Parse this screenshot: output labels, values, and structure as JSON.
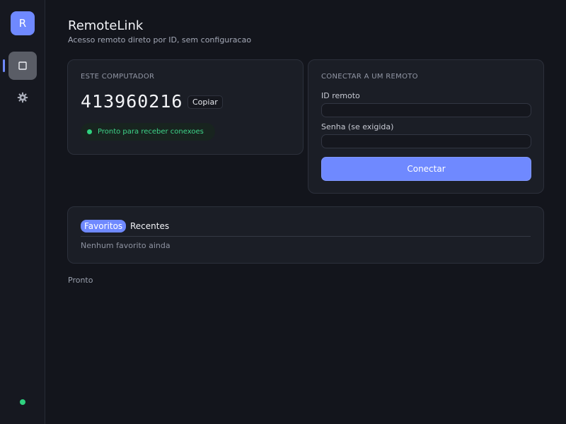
{
  "sidebar": {
    "logo_letter": "R",
    "nav": [
      {
        "name": "home",
        "icon": "square-icon",
        "active": true
      },
      {
        "name": "settings",
        "icon": "gear-icon",
        "active": false
      }
    ],
    "connection_status_color": "#2fd17f"
  },
  "header": {
    "title": "RemoteLink",
    "subtitle": "Acesso remoto direto por ID, sem configuracao"
  },
  "local": {
    "label": "ESTE COMPUTADOR",
    "id": "413960216",
    "copy_label": "Copiar",
    "status": "Pronto para receber conexoes",
    "status_color": "#2fd17f"
  },
  "remote": {
    "label": "CONECTAR A UM REMOTO",
    "id_label": "ID remoto",
    "id_value": "",
    "password_label": "Senha (se exigida)",
    "password_value": "",
    "connect_label": "Conectar"
  },
  "lists": {
    "tabs": [
      {
        "label": "Favoritos",
        "active": true
      },
      {
        "label": "Recentes",
        "active": false
      }
    ],
    "empty_message": "Nenhum favorito ainda"
  },
  "status_bar": {
    "text": "Pronto"
  },
  "colors": {
    "accent": "#6f89ff",
    "success": "#2fd17f",
    "background": "#13151c",
    "card": "#1b1e26"
  }
}
